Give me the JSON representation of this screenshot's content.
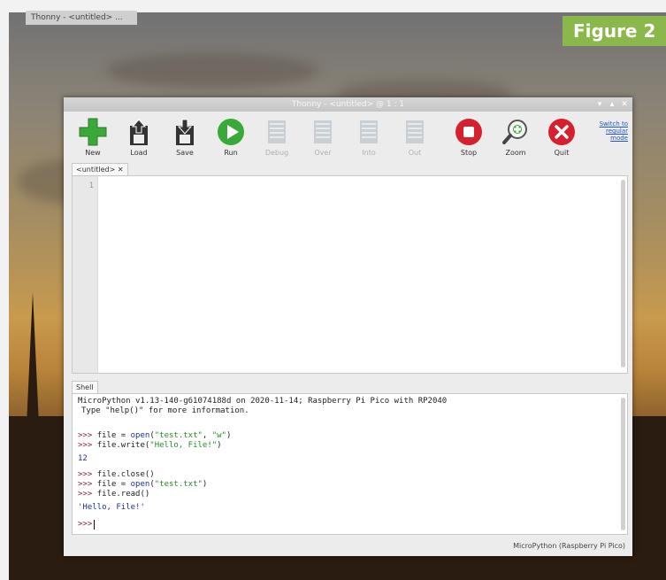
{
  "taskbar": {
    "label": "Thonny - <untitled> ..."
  },
  "figure_label": "Figure 2",
  "window": {
    "title": "Thonny - <untitled> @ 1 : 1",
    "controls": [
      "▾",
      "▴",
      "✕"
    ]
  },
  "toolbar": {
    "items": [
      {
        "label": "New",
        "icon": "new-file-icon",
        "enabled": true,
        "color": "#3aa93a"
      },
      {
        "label": "Load",
        "icon": "load-icon",
        "enabled": true,
        "color": "#333333"
      },
      {
        "label": "Save",
        "icon": "save-icon",
        "enabled": true,
        "color": "#333333"
      },
      {
        "label": "Run",
        "icon": "run-icon",
        "enabled": true,
        "color": "#3aa93a"
      },
      {
        "label": "Debug",
        "icon": "debug-icon",
        "enabled": false
      },
      {
        "label": "Over",
        "icon": "step-over-icon",
        "enabled": false
      },
      {
        "label": "Into",
        "icon": "step-into-icon",
        "enabled": false
      },
      {
        "label": "Out",
        "icon": "step-out-icon",
        "enabled": false
      },
      {
        "label": "Stop",
        "icon": "stop-icon",
        "enabled": true,
        "color": "#d61f2f"
      },
      {
        "label": "Zoom",
        "icon": "zoom-icon",
        "enabled": true,
        "color": "#3aa93a"
      },
      {
        "label": "Quit",
        "icon": "quit-icon",
        "enabled": true,
        "color": "#d61f2f"
      }
    ],
    "switch_mode": {
      "line1": "Switch to",
      "line2": "regular",
      "line3": "mode"
    }
  },
  "editor": {
    "tab_label": "<untitled>",
    "tab_close": "✕",
    "line_numbers": [
      "1"
    ]
  },
  "shell": {
    "tab_label": "Shell",
    "banner_line1": "MicroPython v1.13-140-g61074188d on 2020-11-14; Raspberry Pi Pico with RP2040",
    "banner_line2": "Type \"help()\" for more information.",
    "prompt": ">>>",
    "lines": {
      "l1_pre": "file = ",
      "l1_open": "open",
      "l1_args_a": "(",
      "l1_str1": "\"test.txt\"",
      "l1_sep": ", ",
      "l1_str2": "\"w\"",
      "l1_end": ")",
      "l2_pre": "file.write(",
      "l2_str": "\"Hello, File!\"",
      "l2_end": ")",
      "out1": "12",
      "l3": "file.close()",
      "l4_pre": "file = ",
      "l4_open": "open",
      "l4_a": "(",
      "l4_str": "\"test.txt\"",
      "l4_end": ")",
      "l5": "file.read()",
      "out2": "'Hello, File!'"
    }
  },
  "status": {
    "interpreter": "MicroPython (Raspberry Pi Pico)"
  }
}
